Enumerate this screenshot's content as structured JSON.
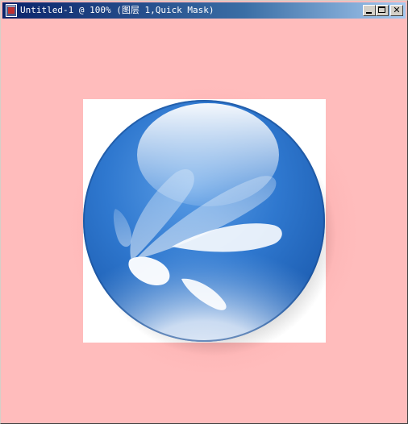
{
  "window": {
    "title": "Untitled-1 @ 100% (图层 1,Quick Mask)",
    "mask_overlay_color": "#ffbcbc",
    "title_bar_color": "#0a246a"
  },
  "controls": {
    "minimize_icon": "minimize-icon",
    "maximize_icon": "maximize-icon",
    "close_icon": "close-icon",
    "close_glyph": "✕"
  },
  "artwork": {
    "subject": "glossy blue sphere with splash pattern",
    "primary_color": "#2a6fc4",
    "highlight_color": "#ffffff"
  }
}
